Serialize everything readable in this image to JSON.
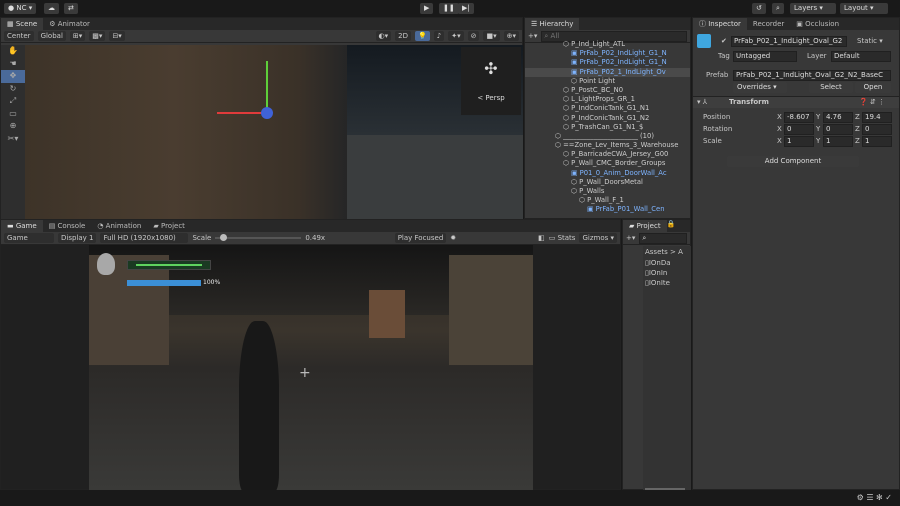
{
  "topbar": {
    "account": "NC",
    "play_icon": "play-icon",
    "pause_icon": "pause-icon",
    "step_icon": "step-icon",
    "layers": "Layers",
    "layout": "Layout"
  },
  "scene": {
    "tabs": [
      "Scene",
      "Animator"
    ],
    "pivot": "Center",
    "space": "Global",
    "mode_2d": "2D",
    "persp": "< Persp"
  },
  "hierarchy": {
    "title": "Hierarchy",
    "search_placeholder": "All",
    "items": [
      {
        "label": "P_Ind_Light_ATL",
        "indent": 1,
        "prefab": false
      },
      {
        "label": "PrFab_P02_IndLight_G1_N",
        "indent": 2,
        "prefab": true
      },
      {
        "label": "PrFab_P02_IndLight_G1_N",
        "indent": 2,
        "prefab": true
      },
      {
        "label": "PrFab_P02_1_IndLight_Ov",
        "indent": 2,
        "prefab": true,
        "selected": true
      },
      {
        "label": "Point Light",
        "indent": 2,
        "prefab": false
      },
      {
        "label": "P_PostC_BC_N0",
        "indent": 1,
        "prefab": false
      },
      {
        "label": "L_LightProps_GR_1",
        "indent": 1,
        "prefab": false
      },
      {
        "label": "P_IndConicTank_G1_N1",
        "indent": 1,
        "prefab": false
      },
      {
        "label": "P_IndConicTank_G1_N2",
        "indent": 1,
        "prefab": false
      },
      {
        "label": "P_TrashCan_G1_N1_$",
        "indent": 1,
        "prefab": false
      },
      {
        "label": "______________________ (10)",
        "indent": 0,
        "prefab": false
      },
      {
        "label": "==Zone_Lev_Items_3_Warehouse",
        "indent": 0,
        "prefab": false
      },
      {
        "label": "P_BarricadeCWA_Jersey_G00",
        "indent": 1,
        "prefab": false
      },
      {
        "label": "P_Wall_CMC_Border_Groups",
        "indent": 1,
        "prefab": false
      },
      {
        "label": "P01_0_Anim_DoorWall_Ac",
        "indent": 2,
        "prefab": true
      },
      {
        "label": "P_Wall_DoorsMetal",
        "indent": 2,
        "prefab": false
      },
      {
        "label": "P_Walls",
        "indent": 2,
        "prefab": false
      },
      {
        "label": "P_Wall_F_1",
        "indent": 3,
        "prefab": false
      },
      {
        "label": "PrFab_P01_Wall_Cen",
        "indent": 4,
        "prefab": true
      }
    ]
  },
  "inspector": {
    "tabs": [
      "Inspector",
      "Recorder",
      "Occlusion"
    ],
    "object_name": "PrFab_P02_1_IndLight_Oval_G2",
    "static": "Static",
    "tag_label": "Tag",
    "tag": "Untagged",
    "layer_label": "Layer",
    "layer": "Default",
    "prefab_label": "Prefab",
    "prefab": "PrFab_P02_1_IndLight_Oval_G2_N2_BaseC",
    "overrides": "Overrides",
    "select": "Select",
    "open": "Open",
    "transform": {
      "title": "Transform",
      "position": {
        "label": "Position",
        "x": "-8.607",
        "y": "4.76",
        "z": "19.4"
      },
      "rotation": {
        "label": "Rotation",
        "x": "0",
        "y": "0",
        "z": "0"
      },
      "scale": {
        "label": "Scale",
        "x": "1",
        "y": "1",
        "z": "1"
      }
    },
    "add_component": "Add Component"
  },
  "game": {
    "tabs": [
      "Game",
      "Console",
      "Animation",
      "Project"
    ],
    "mode": "Game",
    "display": "Display 1",
    "resolution": "Full HD (1920x1080)",
    "scale_label": "Scale",
    "scale_value": "0.49x",
    "scale_fraction": 0.05,
    "play_focused": "Play Focused",
    "stats": "Stats",
    "gizmos": "Gizmos",
    "hud_health_percent": "100%"
  },
  "project": {
    "title": "Project",
    "breadcrumb": "Assets > A",
    "files": [
      "IOnDa",
      "IOnIn",
      "IOnIte"
    ]
  }
}
